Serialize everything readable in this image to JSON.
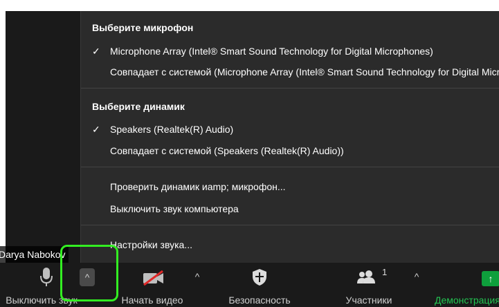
{
  "participant": {
    "name": "Darya Nabokov"
  },
  "audio_menu": {
    "microphone_title": "Выберите микрофон",
    "microphone_items": [
      {
        "checked": true,
        "label": "Microphone Array (Intel® Smart Sound Technology for Digital Microphones)"
      },
      {
        "checked": false,
        "label": "Совпадает с системой (Microphone Array (Intel® Smart Sound Technology for Digital Microphones))"
      }
    ],
    "speaker_title": "Выберите динамик",
    "speaker_items": [
      {
        "checked": true,
        "label": "Speakers (Realtek(R) Audio)"
      },
      {
        "checked": false,
        "label": "Совпадает с системой (Speakers (Realtek(R) Audio))"
      }
    ],
    "test_label": "Проверить динамик иamp; микрофон...",
    "mute_computer_label": "Выключить звук компьютера",
    "settings_label": "Настройки звука...",
    "check_mark": "✓"
  },
  "toolbar": {
    "mute_label": "Выключить звук",
    "video_label": "Начать видео",
    "security_label": "Безопасность",
    "participants_label": "Участники",
    "participants_count": "1",
    "share_label": "Демонстрация",
    "caret_glyph": "^",
    "share_glyph": "↑"
  },
  "colors": {
    "highlight": "#33ee22",
    "share_green": "#0e9f3c",
    "video_off_red": "#e02828"
  }
}
